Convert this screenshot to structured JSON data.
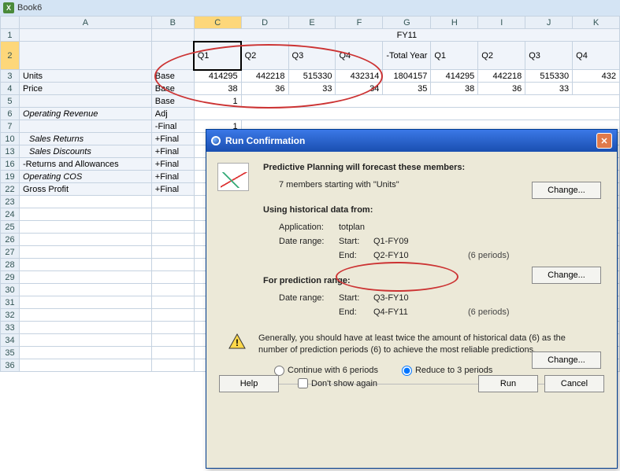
{
  "window": {
    "title": "Book6"
  },
  "columns": [
    "A",
    "B",
    "C",
    "D",
    "E",
    "F",
    "G",
    "H",
    "I",
    "J",
    "K"
  ],
  "header": {
    "fy": "FY11",
    "quarters": [
      "Q1",
      "Q2",
      "Q3",
      "Q4"
    ],
    "total": "-Total Year",
    "quarters2": [
      "Q1",
      "Q2",
      "Q3",
      "Q4"
    ]
  },
  "rows": {
    "r3": {
      "label": "Units",
      "base": "Base",
      "vals": [
        "414295",
        "442218",
        "515330",
        "432314",
        "1804157",
        "414295",
        "442218",
        "515330",
        "432"
      ]
    },
    "r4": {
      "label": "Price",
      "base": "Base",
      "vals": [
        "38",
        "36",
        "33",
        "34",
        "35",
        "38",
        "36",
        "33",
        ""
      ]
    },
    "r5": {
      "label": "",
      "base": "Base",
      "c": "1"
    },
    "r6": {
      "label": "Operating Revenue",
      "base": "Adj"
    },
    "r7": {
      "label": "",
      "base": "-Final",
      "c": "1"
    },
    "r10": {
      "label": "Sales Returns",
      "base": "+Final"
    },
    "r13": {
      "label": "Sales Discounts",
      "base": "+Final"
    },
    "r16": {
      "label": "-Returns and Allowances",
      "base": "+Final"
    },
    "r19": {
      "label": "Operating COS",
      "base": "+Final"
    },
    "r22": {
      "label": "Gross Profit",
      "base": "+Final"
    }
  },
  "emptyRows": [
    "23",
    "24",
    "25",
    "26",
    "27",
    "28",
    "29",
    "30",
    "31",
    "32",
    "33",
    "34",
    "35",
    "36"
  ],
  "dialog": {
    "title": "Run Confirmation",
    "forecastHead": "Predictive Planning will forecast these members:",
    "membersText": "7 members starting with \"Units\"",
    "change": "Change...",
    "histHead": "Using historical data from:",
    "appLabel": "Application:",
    "appVal": "totplan",
    "drLabel": "Date range:",
    "startLbl": "Start:",
    "endLbl": "End:",
    "histStart": "Q1-FY09",
    "histEnd": "Q2-FY10",
    "histPeriods": "(6 periods)",
    "predHead": "For prediction range:",
    "predStart": "Q3-FY10",
    "predEnd": "Q4-FY11",
    "predPeriods": "(6 periods)",
    "warn": "Generally, you should have at least twice the amount of historical data (6) as the number of prediction periods (6) to achieve the most reliable predictions.",
    "radio1": "Continue with 6 periods",
    "radio2": "Reduce to 3 periods",
    "help": "Help",
    "dontshow": "Don't show again",
    "run": "Run",
    "cancel": "Cancel"
  }
}
